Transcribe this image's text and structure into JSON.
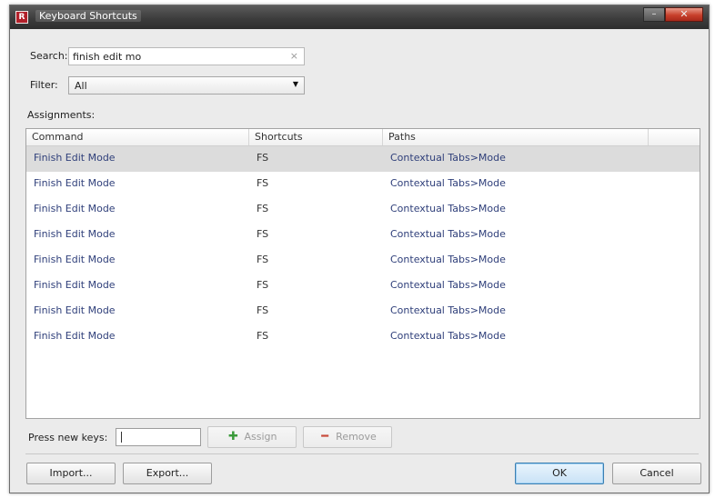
{
  "window": {
    "title": "Keyboard Shortcuts",
    "app_icon_letter": "R",
    "minimize_glyph": "–",
    "close_glyph": "✕"
  },
  "search": {
    "label": "Search:",
    "value": "finish edit mo",
    "clear_glyph": "×"
  },
  "filter": {
    "label": "Filter:",
    "selected": "All",
    "arrow_glyph": "▼"
  },
  "assignments": {
    "label": "Assignments:",
    "columns": [
      "Command",
      "Shortcuts",
      "Paths"
    ],
    "rows": [
      {
        "command": "Finish Edit Mode",
        "shortcut": "FS",
        "path": "Contextual Tabs>Mode"
      },
      {
        "command": "Finish Edit Mode",
        "shortcut": "FS",
        "path": "Contextual Tabs>Mode"
      },
      {
        "command": "Finish Edit Mode",
        "shortcut": "FS",
        "path": "Contextual Tabs>Mode"
      },
      {
        "command": "Finish Edit Mode",
        "shortcut": "FS",
        "path": "Contextual Tabs>Mode"
      },
      {
        "command": "Finish Edit Mode",
        "shortcut": "FS",
        "path": "Contextual Tabs>Mode"
      },
      {
        "command": "Finish Edit Mode",
        "shortcut": "FS",
        "path": "Contextual Tabs>Mode"
      },
      {
        "command": "Finish Edit Mode",
        "shortcut": "FS",
        "path": "Contextual Tabs>Mode"
      },
      {
        "command": "Finish Edit Mode",
        "shortcut": "FS",
        "path": "Contextual Tabs>Mode"
      }
    ]
  },
  "new_keys": {
    "label": "Press new keys:",
    "value": ""
  },
  "buttons": {
    "assign": "Assign",
    "remove": "Remove",
    "import": "Import...",
    "export": "Export...",
    "ok": "OK",
    "cancel": "Cancel"
  },
  "icons": {
    "assign_icon": "plus-icon",
    "remove_icon": "minus-icon"
  },
  "colors": {
    "link_text": "#2f3f7a",
    "selected_row": "#dcdcdc",
    "default_button_border": "#3c7fb1"
  }
}
